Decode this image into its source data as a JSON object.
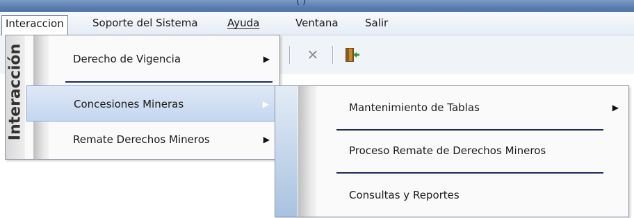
{
  "titlebar": {
    "fragment": "( )"
  },
  "menubar": {
    "items": [
      {
        "label": "Interaccion"
      },
      {
        "label": "Soporte del Sistema"
      },
      {
        "label": "Ayuda"
      },
      {
        "label": "Ventana"
      },
      {
        "label": "Salir"
      }
    ]
  },
  "toolbar": {
    "icons": [
      "close-icon",
      "exit-door-icon"
    ],
    "close_glyph": "✕"
  },
  "menu1": {
    "sidebar_label": "Interacción",
    "items": [
      {
        "label": "Derecho de Vigencia",
        "arrow": "▶"
      },
      {
        "label": "Concesiones Mineras",
        "arrow": "▶"
      },
      {
        "label": "Remate Derechos Mineros",
        "arrow": "▶"
      }
    ]
  },
  "menu2": {
    "items": [
      {
        "label": "Mantenimiento de Tablas",
        "arrow": "▶"
      },
      {
        "label": "Proceso Remate de Derechos Mineros"
      },
      {
        "label": "Consultas y Reportes"
      }
    ]
  },
  "colors": {
    "highlight": "#c4d6ef",
    "separator": "#1f2a5a",
    "titlebar": "#5a7eb0"
  }
}
